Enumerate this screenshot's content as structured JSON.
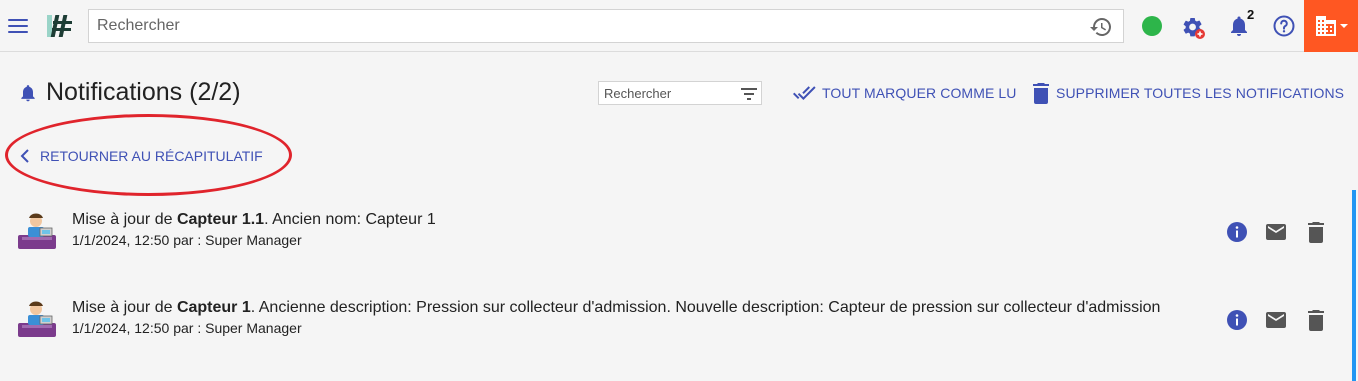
{
  "topbar": {
    "search_placeholder": "Rechercher",
    "notification_count": "2",
    "status_color": "#2db54a",
    "accent_color": "#ff5722",
    "icons": [
      "menu-icon",
      "app-logo",
      "history-icon",
      "gear-icon",
      "bell-icon",
      "help-icon",
      "building-icon"
    ]
  },
  "header": {
    "title": "Notifications (2/2)",
    "filter_placeholder": "Rechercher",
    "mark_all_label": "TOUT MARQUER COMME LU",
    "delete_all_label": "SUPPRIMER TOUTES LES NOTIFICATIONS"
  },
  "back": {
    "label": "RETOURNER AU RÉCAPITULATIF"
  },
  "notifications": [
    {
      "prefix": "Mise à jour de ",
      "subject": "Capteur 1.1",
      "suffix": ". Ancien nom: Capteur 1",
      "meta": "1/1/2024, 12:50 par : Super Manager"
    },
    {
      "prefix": "Mise à jour de ",
      "subject": "Capteur 1",
      "suffix": ". Ancienne description: Pression sur collecteur d'admission. Nouvelle description: Capteur de pression sur collecteur d'admission",
      "meta": "1/1/2024, 12:50 par : Super Manager"
    }
  ],
  "colors": {
    "primary": "#3f51b5",
    "highlight_ellipse": "#e0242c"
  }
}
